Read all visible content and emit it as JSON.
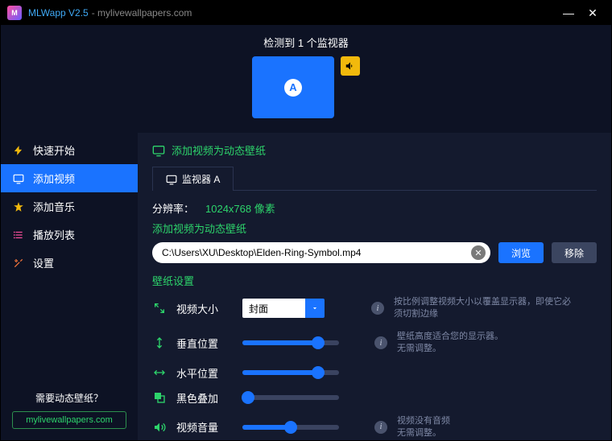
{
  "titlebar": {
    "app": "MLWapp V2.5",
    "sub": "- mylivewallpapers.com"
  },
  "monitors": {
    "detected": "检测到 1 个监视器",
    "letter": "A"
  },
  "sidebar": {
    "items": [
      {
        "label": "快速开始"
      },
      {
        "label": "添加视频"
      },
      {
        "label": "添加音乐"
      },
      {
        "label": "播放列表"
      },
      {
        "label": "设置"
      }
    ],
    "promo_q": "需要动态壁纸？",
    "promo_link": "mylivewallpapers.com"
  },
  "content": {
    "section_title": "添加视频为动态壁纸",
    "tab_label": "监视器 A",
    "res_label": "分辨率：",
    "res_value": "1024x768 像素",
    "sub_title": "添加视频为动态壁纸",
    "path": "C:\\Users\\XU\\Desktop\\Elden-Ring-Symbol.mp4",
    "browse": "浏览",
    "remove": "移除",
    "group_title": "壁纸设置",
    "settings": {
      "size": {
        "label": "视频大小",
        "value": "封面",
        "hint": "按比例调整视频大小以覆盖显示器，即使它必须切割边缘"
      },
      "vpos": {
        "label": "垂直位置",
        "hint": "壁纸高度适合您的显示器。\n无需调整。"
      },
      "hpos": {
        "label": "水平位置"
      },
      "overlay": {
        "label": "黑色叠加"
      },
      "volume": {
        "label": "视频音量",
        "hint": "视频没有音频\n无需调整。"
      }
    }
  }
}
